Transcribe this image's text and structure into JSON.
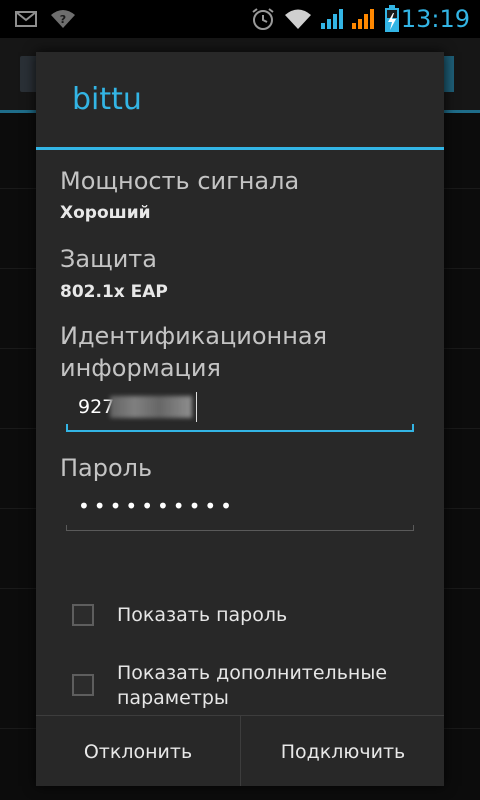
{
  "status_bar": {
    "time": "13:19",
    "icons": [
      "email-icon",
      "wifi-question-icon",
      "alarm-icon",
      "wifi-signal-icon",
      "cell-signal-icon",
      "cell-signal-orange-icon",
      "battery-charging-icon"
    ],
    "accent_color": "#33b5e5",
    "warning_color": "#ff8800"
  },
  "dialog": {
    "title": "bittu",
    "accent_color": "#33b5e5",
    "signal": {
      "label": "Мощность сигнала",
      "value": "Хороший"
    },
    "security": {
      "label": "Защита",
      "value": "802.1x EAP"
    },
    "identity": {
      "label": "Идентификационная информация",
      "value": "927"
    },
    "password": {
      "label": "Пароль",
      "value": "••••••••••"
    },
    "show_password": {
      "label": "Показать пароль",
      "checked": false
    },
    "advanced_options": {
      "label": "Показать дополнительные параметры",
      "checked": false
    },
    "buttons": {
      "cancel": "Отклонить",
      "connect": "Подключить"
    }
  }
}
